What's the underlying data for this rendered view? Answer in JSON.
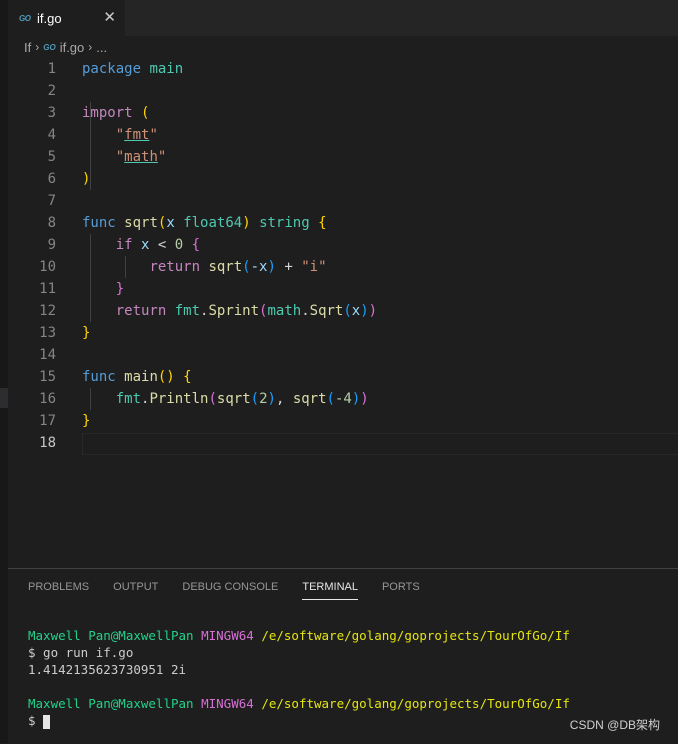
{
  "tab": {
    "icon": "go-file-icon",
    "title": "if.go",
    "close": "✕"
  },
  "breadcrumb": {
    "folder": "If",
    "file": "if.go",
    "more": "..."
  },
  "lines": [
    "1",
    "2",
    "3",
    "4",
    "5",
    "6",
    "7",
    "8",
    "9",
    "10",
    "11",
    "12",
    "13",
    "14",
    "15",
    "16",
    "17",
    "18"
  ],
  "code": {
    "l1": [
      "package",
      "main"
    ],
    "l3": [
      "import",
      "("
    ],
    "l4": [
      "\"",
      "fmt",
      "\""
    ],
    "l5": [
      "\"",
      "math",
      "\""
    ],
    "l6": [
      ")"
    ],
    "l8": [
      "func",
      "sqrt",
      "(",
      "x",
      "float64",
      ")",
      "string",
      "{"
    ],
    "l9": [
      "if",
      "x",
      "<",
      "0",
      "{"
    ],
    "l10": [
      "return",
      "sqrt",
      "(",
      "-x",
      ")",
      "+",
      "\"i\""
    ],
    "l11": [
      "}"
    ],
    "l12": [
      "return",
      "fmt",
      ".",
      "Sprint",
      "(",
      "math",
      ".",
      "Sqrt",
      "(",
      "x",
      ")",
      ")"
    ],
    "l13": [
      "}"
    ],
    "l15": [
      "func",
      "main",
      "()",
      "{"
    ],
    "l16": [
      "fmt",
      ".",
      "Println",
      "(",
      "sqrt",
      "(",
      "2",
      ")",
      ",",
      "sqrt",
      "(",
      "-4",
      ")",
      ")"
    ],
    "l17": [
      "}"
    ]
  },
  "panel": {
    "tabs": [
      "PROBLEMS",
      "OUTPUT",
      "DEBUG CONSOLE",
      "TERMINAL",
      "PORTS"
    ],
    "active": "TERMINAL"
  },
  "terminal": {
    "user": "Maxwell Pan@MaxwellPan",
    "env": "MINGW64",
    "path": "/e/software/golang/goprojects/TourOfGo/If",
    "command": "$ go run if.go",
    "output": "1.4142135623730951 2i",
    "prompt": "$"
  },
  "watermark": "CSDN @DB架构",
  "colors": {
    "background": "#1e1e1e",
    "keyword": "#569cd6",
    "function": "#dcdcaa",
    "type": "#4ec9b0",
    "string": "#ce9178",
    "terminal_green": "#23d18b"
  }
}
